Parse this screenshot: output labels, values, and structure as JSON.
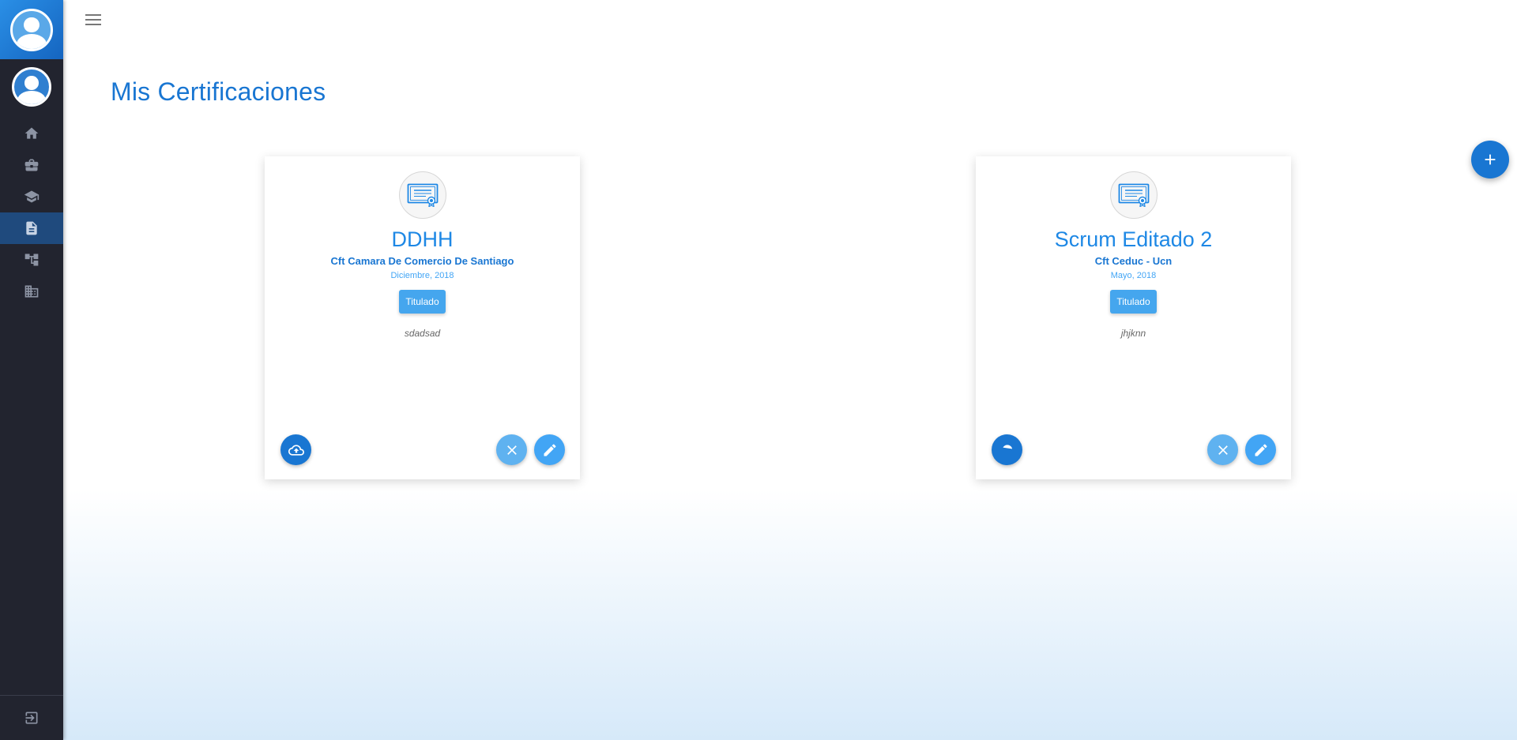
{
  "page": {
    "title": "Mis Certificaciones"
  },
  "sidebar": {
    "items": [
      {
        "icon": "home-icon",
        "active": false
      },
      {
        "icon": "briefcase-icon",
        "active": false
      },
      {
        "icon": "graduation-cap-icon",
        "active": false
      },
      {
        "icon": "document-icon",
        "active": true
      },
      {
        "icon": "sitemap-icon",
        "active": false
      },
      {
        "icon": "building-icon",
        "active": false
      }
    ],
    "logout_icon": "logout-icon"
  },
  "certifications": [
    {
      "name": "DDHH",
      "institution": "Cft Camara De Comercio De Santiago",
      "date": "Diciembre, 2018",
      "status": "Titulado",
      "description": "sdadsad"
    },
    {
      "name": "Scrum Editado 2",
      "institution": "Cft Ceduc - Ucn",
      "date": "Mayo, 2018",
      "status": "Titulado",
      "description": "jhjknn"
    }
  ],
  "colors": {
    "primary": "#1976d2",
    "accent": "#42a5f5",
    "sidebar_bg": "#22242f",
    "sidebar_active": "#1f4a7d"
  }
}
